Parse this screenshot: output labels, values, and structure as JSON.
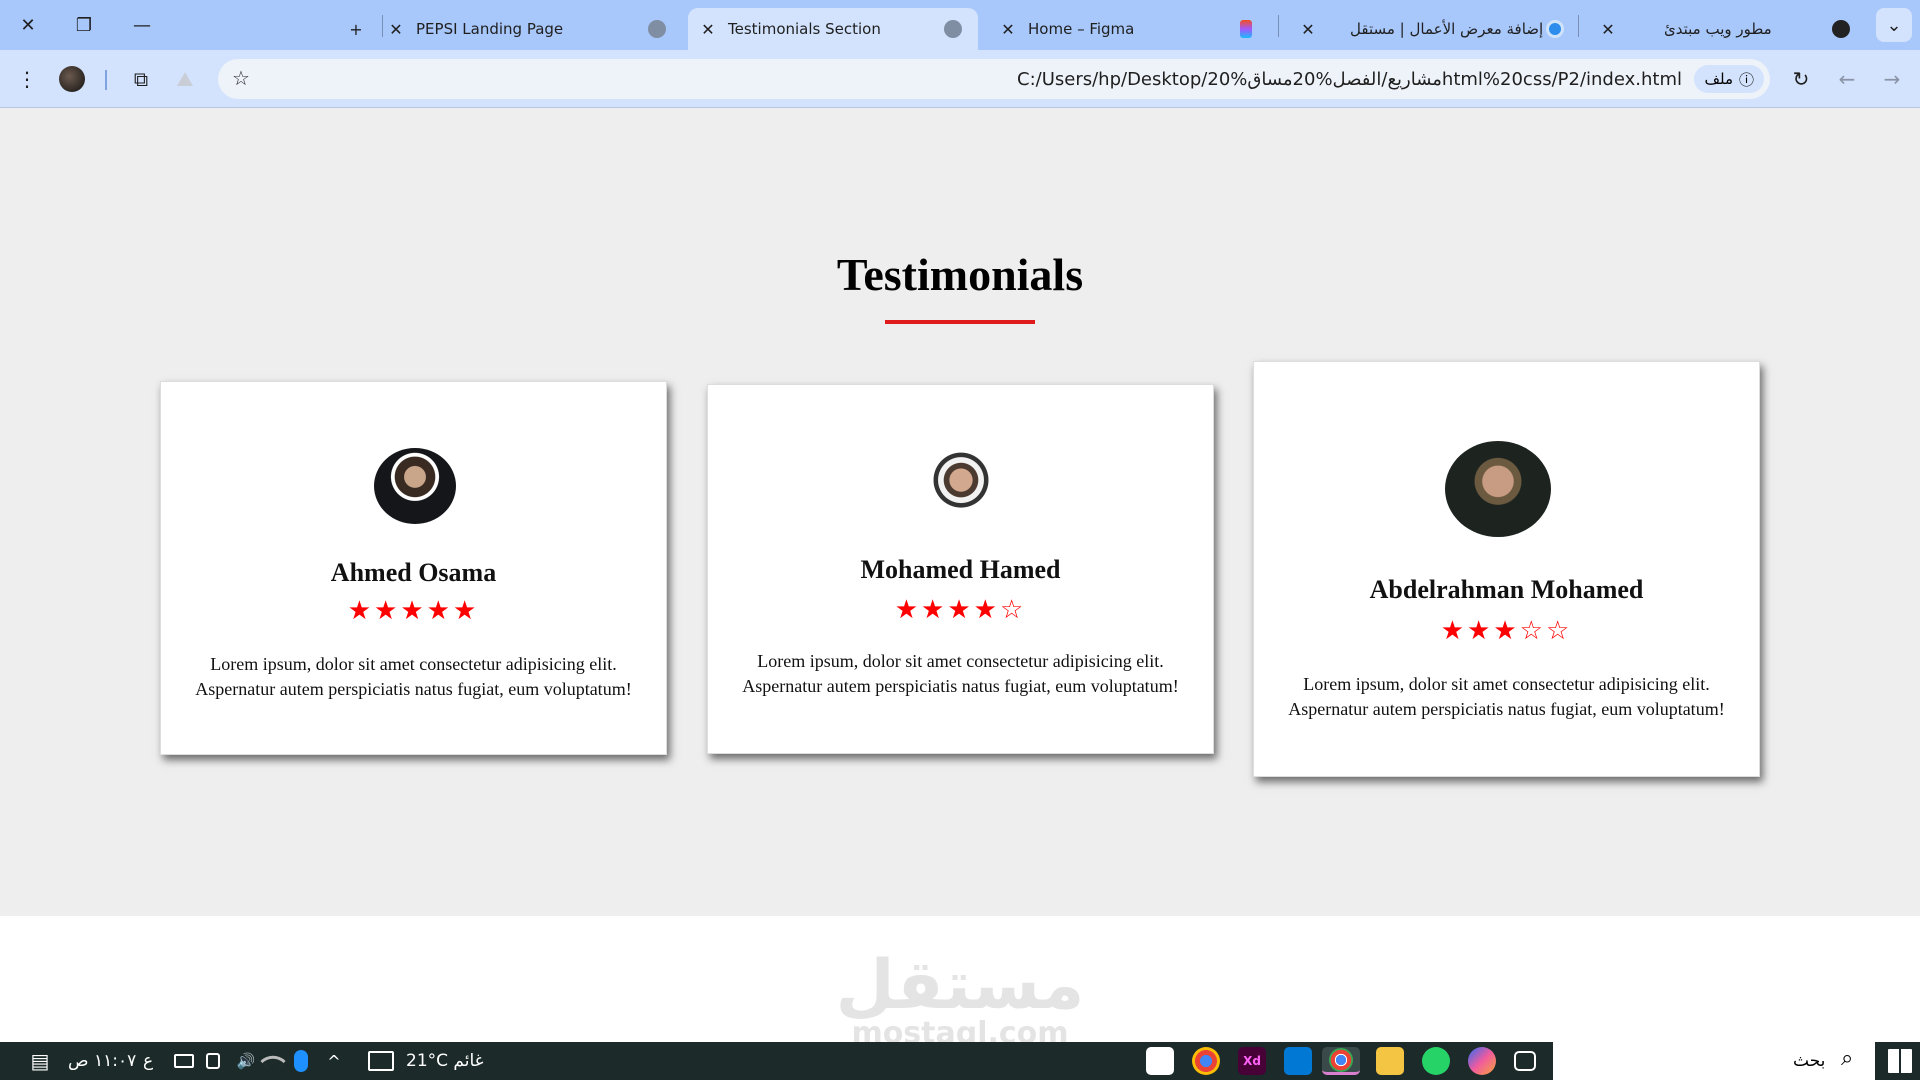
{
  "browser": {
    "tabs": [
      {
        "title": "PEPSI Landing Page"
      },
      {
        "title": "Testimonials Section"
      },
      {
        "title": "Home – Figma"
      },
      {
        "title": "إضافة معرض الأعمال | مستقل"
      },
      {
        "title": "مطور ويب مبتدئ"
      }
    ],
    "address": "C:/Users/hp/Desktop/مشاريع/الفصل%20مساق%20html%20css/P2/index.html",
    "chip_label": "ملف",
    "icons": {
      "close": "✕",
      "new_tab": "+",
      "minimize": "—",
      "restore": "❐",
      "more": "⋮",
      "extensions": "⧉",
      "star": "☆",
      "reload": "↻",
      "back": "←",
      "forward": "→",
      "tab_list": "⌄",
      "info": "ⓘ"
    }
  },
  "page": {
    "title": "Testimonials",
    "testimonials": [
      {
        "name": "Ahmed Osama",
        "stars": "★★★★★",
        "text": "Lorem ipsum, dolor sit amet consectetur adipisicing elit. Aspernatur autem perspiciatis natus fugiat, eum voluptatum!",
        "rating": 5
      },
      {
        "name": "Mohamed Hamed",
        "stars": "★★★★☆",
        "text": "Lorem ipsum, dolor sit amet consectetur adipisicing elit. Aspernatur autem perspiciatis natus fugiat, eum voluptatum!",
        "rating": 4
      },
      {
        "name": "Abdelrahman Mohamed",
        "stars": "★★★☆☆",
        "text": "Lorem ipsum, dolor sit amet consectetur adipisicing elit. Aspernatur autem perspiciatis natus fugiat, eum voluptatum!",
        "rating": 3
      }
    ],
    "colors": {
      "accent": "#e01b1b",
      "star": "#ff0000"
    }
  },
  "watermark": {
    "arabic": "مستقل",
    "latin": "mostaql.com"
  },
  "taskbar": {
    "time": "١١:٠٧ ص",
    "lang": "ع",
    "weather": "21°C  غائم",
    "search_label": "بحث",
    "icons": {
      "notifications": "▤",
      "chevron": "^",
      "volume": "🔊",
      "search": "⌕"
    }
  }
}
